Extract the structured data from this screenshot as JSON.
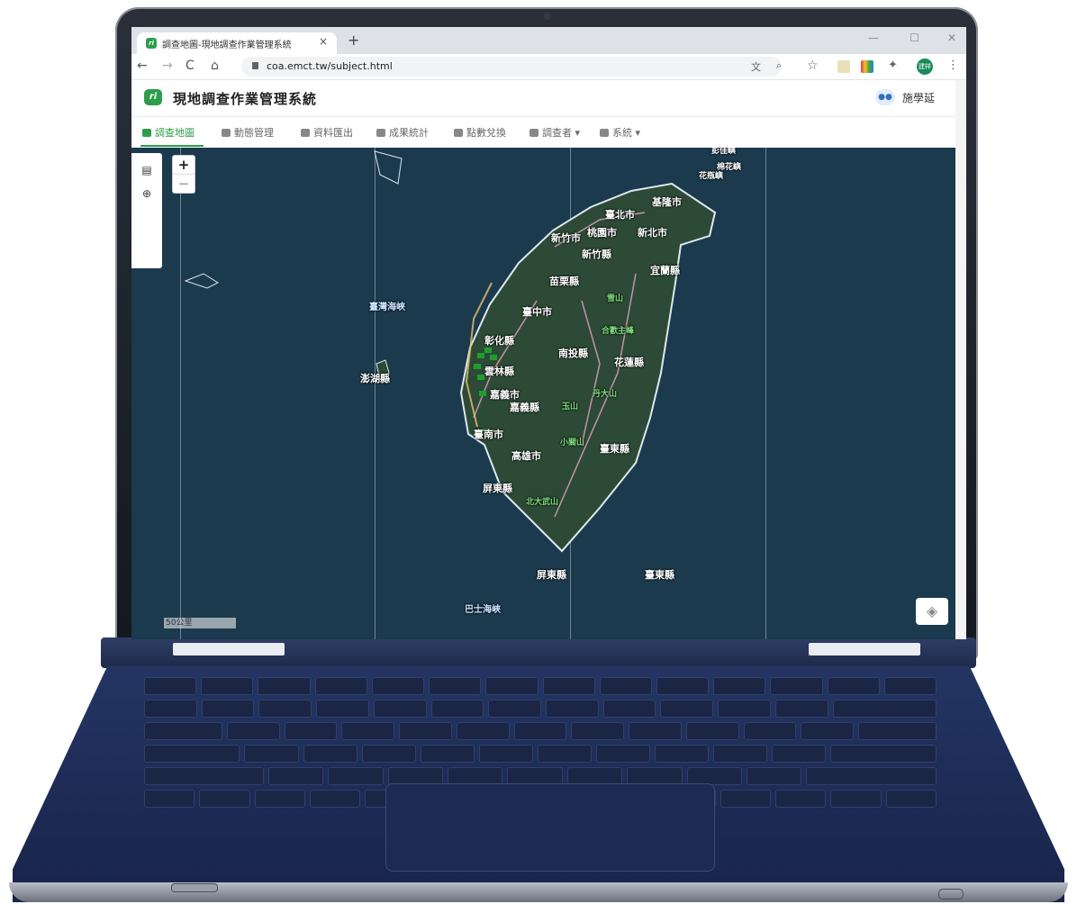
{
  "browser": {
    "tab_title": "調查地圖-現地調查作業管理系統",
    "tab_close": "×",
    "new_tab": "+",
    "url": "coa.emct.tw/subject.html",
    "profile_initial": "建祥",
    "window_minimize": "—",
    "window_maximize": "☐",
    "window_close": "✕"
  },
  "app": {
    "title": "現地調查作業管理系統",
    "logo_text": "ri",
    "user_name": "施學延"
  },
  "menu": {
    "items": [
      {
        "label": "調查地圖"
      },
      {
        "label": "動態管理"
      },
      {
        "label": "資料匯出"
      },
      {
        "label": "成果統計"
      },
      {
        "label": "點數兌換"
      },
      {
        "label": "調查者 ▾"
      },
      {
        "label": "系統 ▾"
      }
    ]
  },
  "map": {
    "zoom_in": "+",
    "zoom_out": "−",
    "scale_label": "50公里",
    "seas": [
      "臺灣海峽",
      "巴士海峽"
    ],
    "islands": [
      "彭佳嶼",
      "棉花嶼",
      "花瓶嶼"
    ],
    "counties": [
      "基隆市",
      "臺北市",
      "新北市",
      "桃園市",
      "新竹市",
      "新竹縣",
      "宜蘭縣",
      "苗栗縣",
      "臺中市",
      "彰化縣",
      "南投縣",
      "花蓮縣",
      "雲林縣",
      "嘉義市",
      "嘉義縣",
      "臺南市",
      "高雄市",
      "臺東縣",
      "屏東縣",
      "澎湖縣"
    ],
    "bottom_labels": [
      "屏東縣",
      "臺東縣"
    ],
    "mountains": [
      "雪山",
      "合歡主峰",
      "玉山",
      "丹大山",
      "小關山",
      "北大武山"
    ],
    "colors": {
      "sea": "#1b3a4d",
      "land": "#2d4a36",
      "accent": "#2e9d4a"
    }
  }
}
